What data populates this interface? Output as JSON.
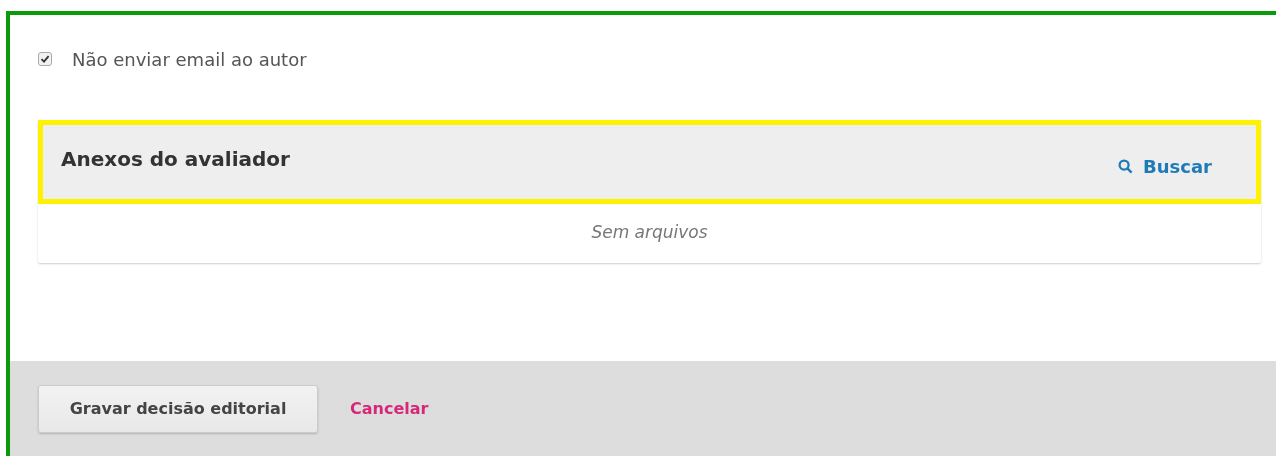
{
  "notify_checkbox": {
    "label": "Não enviar email ao autor",
    "checked": true
  },
  "attachments": {
    "title": "Anexos do avaliador",
    "search_link": "Buscar",
    "highlighted": true,
    "empty_text": "Sem arquivos"
  },
  "footer": {
    "buttons": [
      {
        "kind": "primary",
        "label": "Gravar decisão editorial"
      },
      {
        "kind": "link",
        "label": "Cancelar"
      }
    ]
  }
}
